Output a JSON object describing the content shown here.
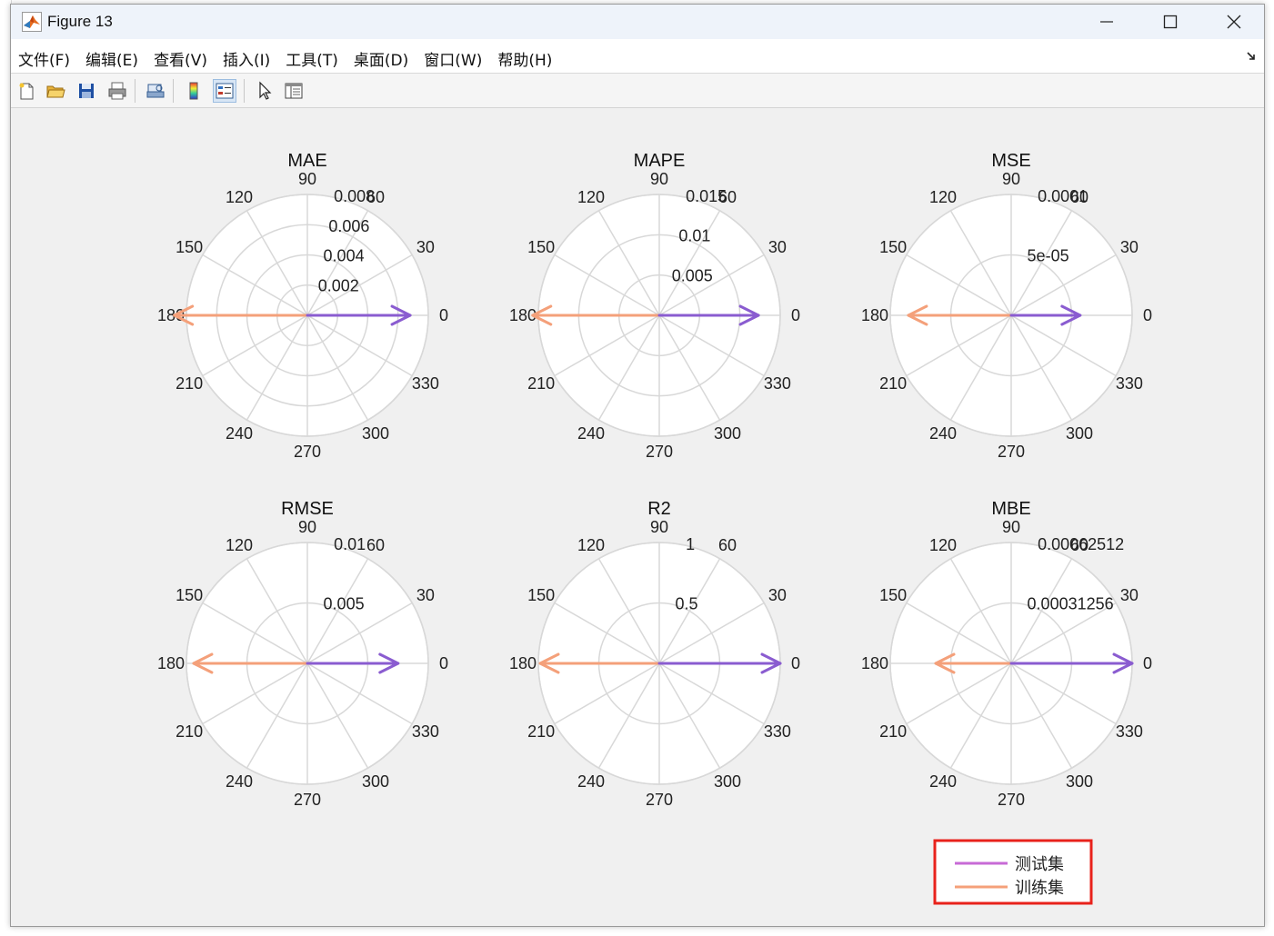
{
  "window": {
    "title": "Figure 13"
  },
  "menu": {
    "items": [
      "文件(F)",
      "编辑(E)",
      "查看(V)",
      "插入(I)",
      "工具(T)",
      "桌面(D)",
      "窗口(W)",
      "帮助(H)"
    ]
  },
  "toolbar": {
    "buttons": [
      "new-figure",
      "open-file",
      "save",
      "print",
      "print-preview",
      "colorbar",
      "legend",
      "edit-plot",
      "property-inspector"
    ],
    "pressed": "legend"
  },
  "colors": {
    "test_series": "#8a5cd0",
    "train_series": "#f4a07a",
    "legend_test": "#c76ad6",
    "legend_train": "#f5a07a",
    "highlight_box": "#e8221b",
    "grid": "#d8d8d8"
  },
  "legend": {
    "entries": [
      "测试集",
      "训练集"
    ]
  },
  "chart_data": [
    {
      "type": "compass",
      "title": "MAE",
      "rmax": 0.008,
      "radial_ticks": [
        "0.002",
        "0.004",
        "0.006",
        "0.008"
      ],
      "radial_values": [
        0.002,
        0.004,
        0.006,
        0.008
      ],
      "angle_ticks": [
        0,
        30,
        60,
        90,
        120,
        150,
        180,
        210,
        240,
        270,
        300,
        330
      ],
      "series": [
        {
          "name": "测试集",
          "angle": 0,
          "magnitude": 0.0068
        },
        {
          "name": "训练集",
          "angle": 180,
          "magnitude": 0.0088
        }
      ]
    },
    {
      "type": "compass",
      "title": "MAPE",
      "rmax": 0.015,
      "radial_ticks": [
        "0.005",
        "0.01",
        "0.015"
      ],
      "radial_values": [
        0.005,
        0.01,
        0.015
      ],
      "angle_ticks": [
        0,
        30,
        60,
        90,
        120,
        150,
        180,
        210,
        240,
        270,
        300,
        330
      ],
      "series": [
        {
          "name": "测试集",
          "angle": 0,
          "magnitude": 0.0123
        },
        {
          "name": "训练集",
          "angle": 180,
          "magnitude": 0.0157
        }
      ]
    },
    {
      "type": "compass",
      "title": "MSE",
      "rmax": 0.0001,
      "radial_ticks": [
        "5e-05",
        "0.0001"
      ],
      "radial_values": [
        5e-05,
        0.0001
      ],
      "angle_ticks": [
        0,
        30,
        60,
        90,
        120,
        150,
        180,
        210,
        240,
        270,
        300,
        330
      ],
      "series": [
        {
          "name": "测试集",
          "angle": 0,
          "magnitude": 5.7e-05
        },
        {
          "name": "训练集",
          "angle": 180,
          "magnitude": 8.5e-05
        }
      ]
    },
    {
      "type": "compass",
      "title": "RMSE",
      "rmax": 0.01,
      "radial_ticks": [
        "0.005",
        "0.01"
      ],
      "radial_values": [
        0.005,
        0.01
      ],
      "angle_ticks": [
        0,
        30,
        60,
        90,
        120,
        150,
        180,
        210,
        240,
        270,
        300,
        330
      ],
      "series": [
        {
          "name": "测试集",
          "angle": 0,
          "magnitude": 0.0075
        },
        {
          "name": "训练集",
          "angle": 180,
          "magnitude": 0.0094
        }
      ]
    },
    {
      "type": "compass",
      "title": "R2",
      "rmax": 1,
      "radial_ticks": [
        "0.5",
        "1"
      ],
      "radial_values": [
        0.5,
        1
      ],
      "angle_ticks": [
        0,
        30,
        60,
        90,
        120,
        150,
        180,
        210,
        240,
        270,
        300,
        330
      ],
      "series": [
        {
          "name": "测试集",
          "angle": 0,
          "magnitude": 1.0
        },
        {
          "name": "训练集",
          "angle": 180,
          "magnitude": 0.985
        }
      ]
    },
    {
      "type": "compass",
      "title": "MBE",
      "rmax": 0.00062512,
      "radial_ticks": [
        "0.00031256",
        "0.00062512"
      ],
      "radial_values": [
        0.00031256,
        0.00062512
      ],
      "angle_ticks": [
        0,
        30,
        60,
        90,
        120,
        150,
        180,
        210,
        240,
        270,
        300,
        330
      ],
      "series": [
        {
          "name": "测试集",
          "angle": 0,
          "magnitude": 0.00062512
        },
        {
          "name": "训练集",
          "angle": 180,
          "magnitude": 0.00039
        }
      ]
    }
  ]
}
